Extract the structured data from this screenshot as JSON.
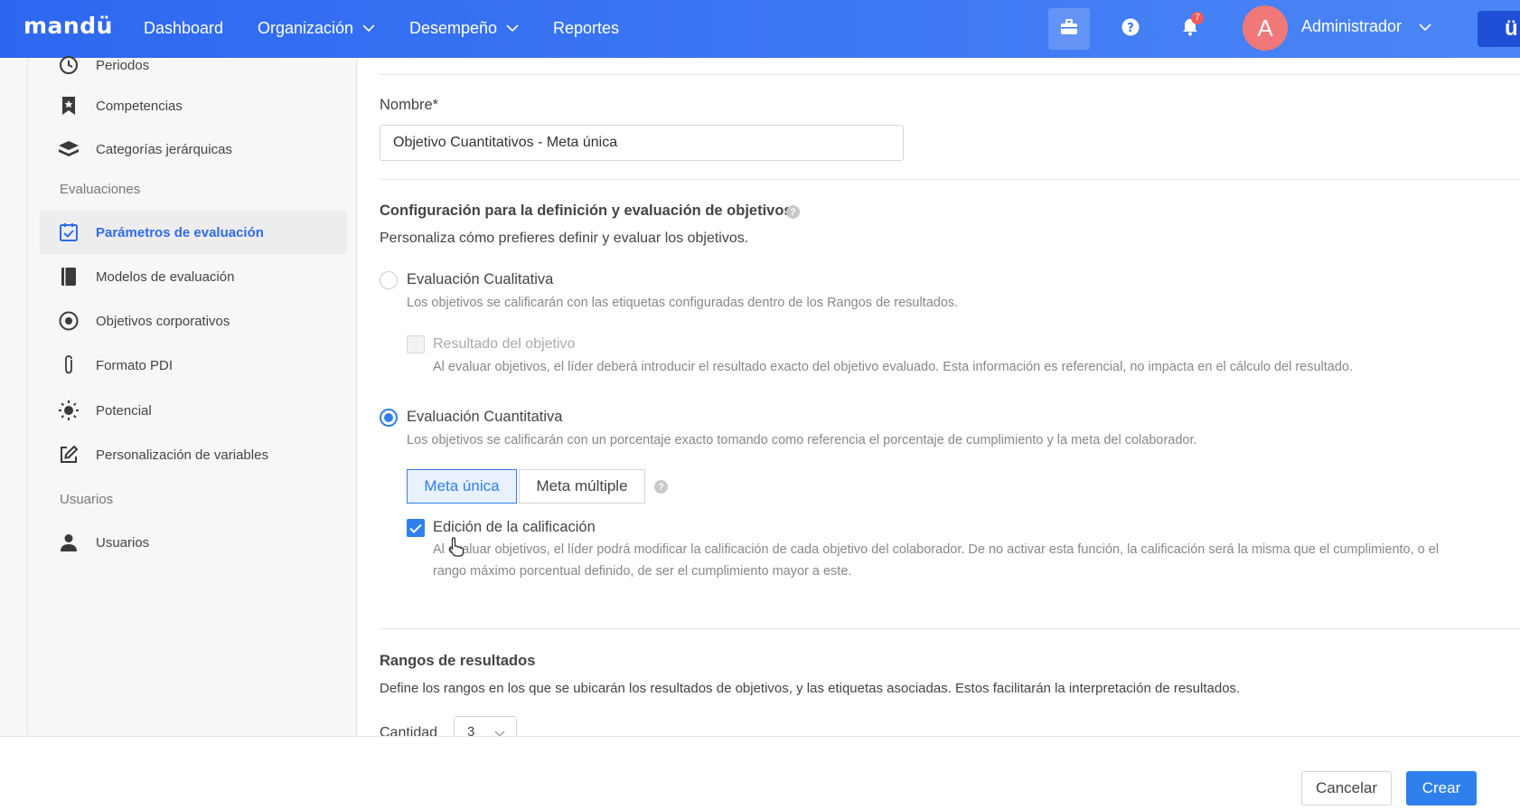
{
  "nav": {
    "logo": "mandü",
    "items": [
      {
        "label": "Dashboard"
      },
      {
        "label": "Organización"
      },
      {
        "label": "Desempeño"
      },
      {
        "label": "Reportes"
      }
    ],
    "notifications_count": "7",
    "avatar_letter": "A",
    "user_name": "Administrador",
    "app_letter": "ü",
    "accent": "#2d67f0"
  },
  "sidebar": {
    "items_top": [
      {
        "label": "Periodos",
        "icon": "clock-icon"
      },
      {
        "label": "Competencias",
        "icon": "bookmark-icon"
      },
      {
        "label": "Categorías jerárquicas",
        "icon": "layers-icon"
      }
    ],
    "group_evaluaciones": "Evaluaciones",
    "items_eval": [
      {
        "label": "Parámetros de evaluación",
        "icon": "calendar-check-icon",
        "active": true
      },
      {
        "label": "Modelos de evaluación",
        "icon": "book-icon"
      },
      {
        "label": "Objetivos corporativos",
        "icon": "target-icon"
      },
      {
        "label": "Formato PDI",
        "icon": "paperclip-icon"
      },
      {
        "label": "Potencial",
        "icon": "sun-icon"
      },
      {
        "label": "Personalización de variables",
        "icon": "edit-icon"
      }
    ],
    "group_usuarios": "Usuarios",
    "items_users": [
      {
        "label": "Usuarios",
        "icon": "user-icon"
      }
    ]
  },
  "form": {
    "name_label": "Nombre*",
    "name_value": "Objetivo Cuantitativos - Meta única",
    "config_title": "Configuración para la definición y evaluación de objetivos",
    "config_subtitle": "Personaliza cómo prefieres definir y evaluar los objetivos.",
    "qualitative_label": "Evaluación Cualitativa",
    "qualitative_desc": "Los objetivos se calificarán con las etiquetas configuradas dentro de los Rangos de resultados.",
    "result_label": "Resultado del objetivo",
    "result_desc": "Al evaluar objetivos, el líder deberá introducir el resultado exacto del objetivo evaluado. Esta información es referencial, no impacta en el cálculo del resultado.",
    "quantitative_label": "Evaluación Cuantitativa",
    "quantitative_desc": "Los objetivos se calificarán con un porcentaje exacto tomando como referencia el porcentaje de cumplimiento y la meta del colaborador.",
    "seg_single": "Meta única",
    "seg_multiple": "Meta múltiple",
    "edit_label": "Edición de la calificación",
    "edit_desc_1": "Al evaluar objetivos, el líder podrá modificar la calificación de cada objetivo del colaborador. De no activar esta función, la calificación será la misma que el cumplimiento, o el",
    "edit_desc_2": "rango máximo porcentual definido, de ser el cumplimiento mayor a este.",
    "ranges_title": "Rangos de resultados",
    "ranges_desc": "Define los rangos en los que se ubicarán los resultados de objetivos, y las etiquetas asociadas. Estos facilitarán la interpretación de resultados.",
    "quantity_label": "Cantidad",
    "quantity_value": "3"
  },
  "footer": {
    "cancel": "Cancelar",
    "create": "Crear"
  }
}
